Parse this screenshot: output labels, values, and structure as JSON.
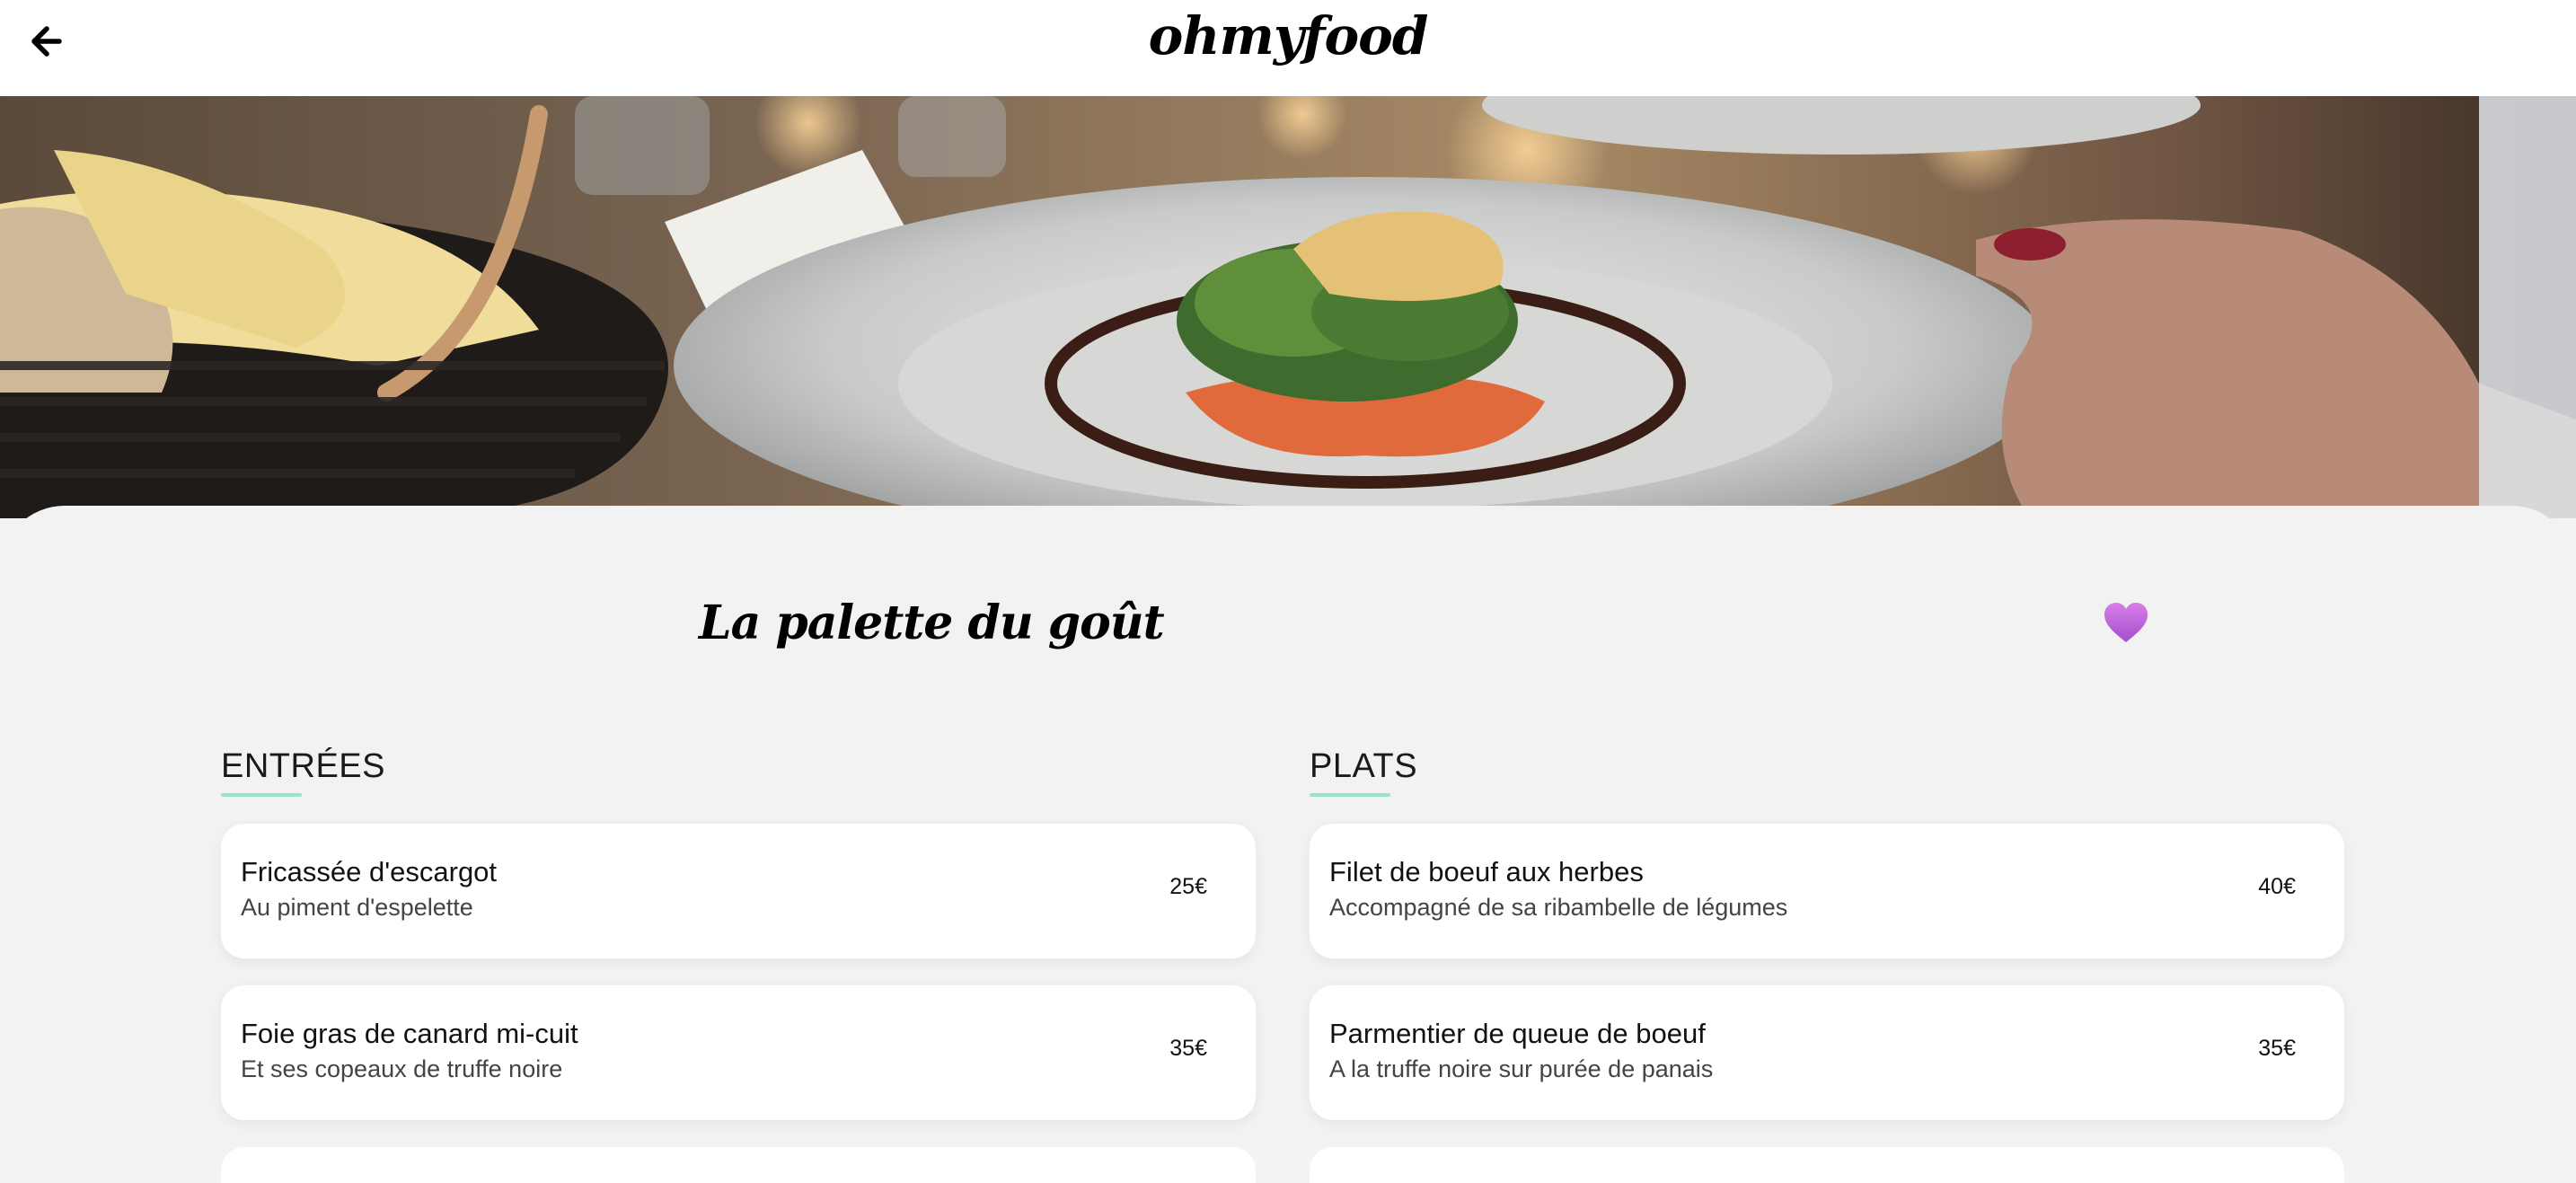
{
  "header": {
    "back_icon": "arrow-left-icon",
    "logo": "ohmyfood"
  },
  "hero": {
    "image": "plated-dish-photo"
  },
  "restaurant": {
    "title": "La palette du goût",
    "like_icon": "heart-icon",
    "like_color": "#b85fd9"
  },
  "colors": {
    "accent": "#99e2d0",
    "panel_bg": "#f2f2f2",
    "card_bg": "#ffffff"
  },
  "menu": {
    "entrees": {
      "title": "ENTRÉES",
      "items": [
        {
          "name": "Fricassée d'escargot",
          "description": "Au piment d'espelette",
          "price": "25€"
        },
        {
          "name": "Foie gras de canard mi-cuit",
          "description": "Et ses copeaux de truffe noire",
          "price": "35€"
        }
      ]
    },
    "plats": {
      "title": "PLATS",
      "items": [
        {
          "name": "Filet de boeuf aux herbes",
          "description": "Accompagné de sa ribambelle de légumes",
          "price": "40€"
        },
        {
          "name": "Parmentier de queue de boeuf",
          "description": "A la truffe noire sur purée de panais",
          "price": "35€"
        }
      ]
    }
  }
}
